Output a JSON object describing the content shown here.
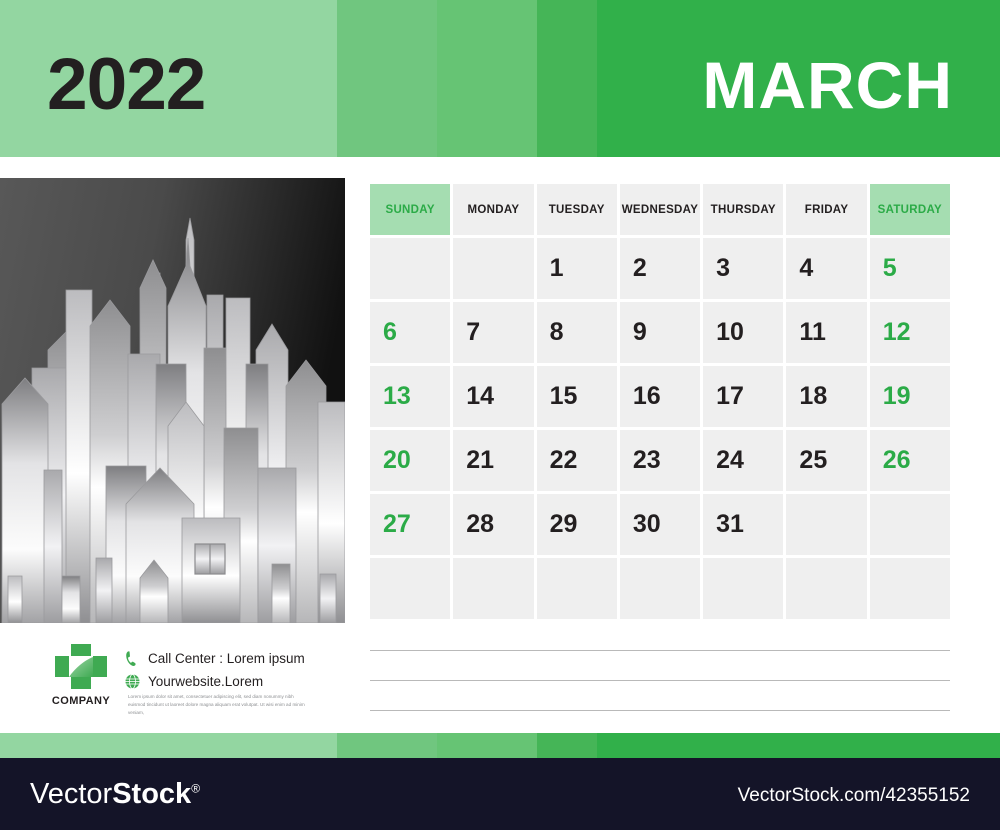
{
  "header": {
    "year": "2022",
    "month": "MARCH",
    "bands": [
      "#93d6a1",
      "#70c67f",
      "#66c474",
      "#45b557",
      "#31b04a"
    ]
  },
  "photo": {
    "alt": "city-skyline-illustration",
    "style": "silver gradient buildings on dark gradient background"
  },
  "calendar": {
    "weekdays": [
      {
        "label": "SUNDAY",
        "weekend": true
      },
      {
        "label": "MONDAY",
        "weekend": false
      },
      {
        "label": "TUESDAY",
        "weekend": false
      },
      {
        "label": "WEDNESDAY",
        "weekend": false
      },
      {
        "label": "THURSDAY",
        "weekend": false
      },
      {
        "label": "FRIDAY",
        "weekend": false
      },
      {
        "label": "SATURDAY",
        "weekend": true
      }
    ],
    "weeks": [
      [
        {
          "d": "",
          "wk": true
        },
        {
          "d": "",
          "wk": false
        },
        {
          "d": "1",
          "wk": false
        },
        {
          "d": "2",
          "wk": false
        },
        {
          "d": "3",
          "wk": false
        },
        {
          "d": "4",
          "wk": false
        },
        {
          "d": "5",
          "wk": true
        }
      ],
      [
        {
          "d": "6",
          "wk": true
        },
        {
          "d": "7",
          "wk": false
        },
        {
          "d": "8",
          "wk": false
        },
        {
          "d": "9",
          "wk": false
        },
        {
          "d": "10",
          "wk": false
        },
        {
          "d": "11",
          "wk": false
        },
        {
          "d": "12",
          "wk": true
        }
      ],
      [
        {
          "d": "13",
          "wk": true
        },
        {
          "d": "14",
          "wk": false
        },
        {
          "d": "15",
          "wk": false
        },
        {
          "d": "16",
          "wk": false
        },
        {
          "d": "17",
          "wk": false
        },
        {
          "d": "18",
          "wk": false
        },
        {
          "d": "19",
          "wk": true
        }
      ],
      [
        {
          "d": "20",
          "wk": true
        },
        {
          "d": "21",
          "wk": false
        },
        {
          "d": "22",
          "wk": false
        },
        {
          "d": "23",
          "wk": false
        },
        {
          "d": "24",
          "wk": false
        },
        {
          "d": "25",
          "wk": false
        },
        {
          "d": "26",
          "wk": true
        }
      ],
      [
        {
          "d": "27",
          "wk": true
        },
        {
          "d": "28",
          "wk": false
        },
        {
          "d": "29",
          "wk": false
        },
        {
          "d": "30",
          "wk": false
        },
        {
          "d": "31",
          "wk": false
        },
        {
          "d": "",
          "wk": false
        },
        {
          "d": "",
          "wk": true
        }
      ],
      [
        {
          "d": "",
          "wk": true
        },
        {
          "d": "",
          "wk": false
        },
        {
          "d": "",
          "wk": false
        },
        {
          "d": "",
          "wk": false
        },
        {
          "d": "",
          "wk": false
        },
        {
          "d": "",
          "wk": false
        },
        {
          "d": "",
          "wk": true
        }
      ]
    ],
    "colors": {
      "cell_bg": "#efefef",
      "weekend_header_bg": "#a5ddb1",
      "weekend_text": "#2bab47",
      "text": "#231f20"
    }
  },
  "footer": {
    "company_name": "COMPANY",
    "logo_icon": "company-square-logo",
    "contacts": [
      {
        "icon": "phone-icon",
        "text": "Call Center : Lorem ipsum"
      },
      {
        "icon": "globe-icon",
        "text": "Yourwebsite.Lorem"
      }
    ],
    "lorem": "Lorem ipsum dolor sit amet, consectetuer adipiscing elit, sed diam nonummy nibh euismod tincidunt ut laoreet dolore magna aliquam erat volutpat. Ut wisi enim ad minim veniam,",
    "note_lines": 3
  },
  "watermark": {
    "brand_thin": "Vector",
    "brand_bold": "Stock",
    "registered": "®",
    "url": "VectorStock.com/42355152",
    "bg": "#141428"
  }
}
